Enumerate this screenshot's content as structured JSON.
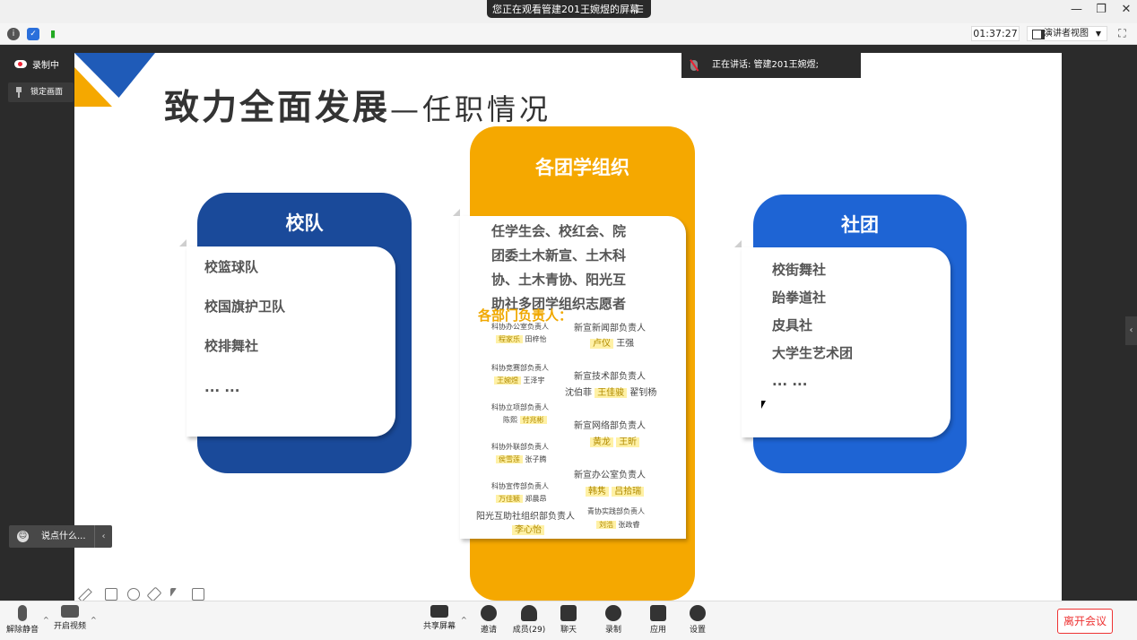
{
  "titlebar": {
    "share_text": "您正在观看管建201王婉煜的屏幕",
    "menu_icon": "menu-icon",
    "minimize": "—",
    "restore": "❐",
    "close": "✕"
  },
  "infobar": {
    "timer": "01:37:27",
    "view_label": "演讲者视图",
    "icons": [
      "info-icon",
      "shield-icon",
      "signal-icon"
    ]
  },
  "left_panel": {
    "recording": "录制中",
    "lock_screen": "锁定画面",
    "chat_placeholder": "说点什么..."
  },
  "speaker": {
    "text": "正在讲话: 管建201王婉煜;"
  },
  "slide": {
    "title": "致力全面发展",
    "subtitle": "—任职情况",
    "left_card": {
      "header": "校队",
      "items": [
        "校篮球队",
        "校国旗护卫队",
        "校排舞社",
        "... ..."
      ],
      "color": "#1a4a9a"
    },
    "middle_card": {
      "header": "各团学组织",
      "lines": [
        "任学生会、校红会、院",
        "团委土木新宣、土木科",
        "协、土木青协、阳光互",
        "助社多团学组织志愿者"
      ],
      "dept_label": "各部门负责人：",
      "color": "#f5a800",
      "left_col": [
        {
          "role": "科协办公室负责人",
          "names": [
            "程家乐",
            "田梓怡"
          ]
        },
        {
          "role": "科协竞赛部负责人",
          "names": [
            "王婉煜",
            "王泽宇"
          ]
        },
        {
          "role": "科协立项部负责人",
          "names": [
            "陈熙",
            "付兆彬"
          ]
        },
        {
          "role": "科协外联部负责人",
          "names": [
            "侯雪莲",
            "张子腾"
          ]
        },
        {
          "role": "科协宣传部负责人",
          "names": [
            "万佳颖",
            "郑晨昂"
          ]
        },
        {
          "role": "阳光互助社组织部负责人",
          "names": [
            "李心怡"
          ]
        }
      ],
      "right_col": [
        {
          "role": "新宣新闻部负责人",
          "names": [
            "卢仪",
            "王强"
          ]
        },
        {
          "role": "新宣技术部负责人",
          "names": [
            "沈伯菲",
            "王佳骏",
            "翟钊杨"
          ]
        },
        {
          "role": "新宣网络部负责人",
          "names": [
            "黄龙",
            "王昕"
          ]
        },
        {
          "role": "新宣办公室负责人",
          "names": [
            "韩隽",
            "吕拾瑞"
          ]
        },
        {
          "role": "青协实践部负责人",
          "names": [
            "刘浩",
            "张政睿"
          ]
        }
      ]
    },
    "right_card": {
      "header": "社团",
      "items": [
        "校街舞社",
        "跆拳道社",
        "皮具社",
        "大学生艺术团",
        "... ..."
      ],
      "color": "#1e64d4"
    }
  },
  "bottombar": {
    "unmute": "解除静音",
    "start_video": "开启视频",
    "share_screen": "共享屏幕",
    "invite": "邀请",
    "members": "成员(29)",
    "chat": "聊天",
    "record": "录制",
    "apps": "应用",
    "settings": "设置",
    "leave": "离开会议"
  }
}
